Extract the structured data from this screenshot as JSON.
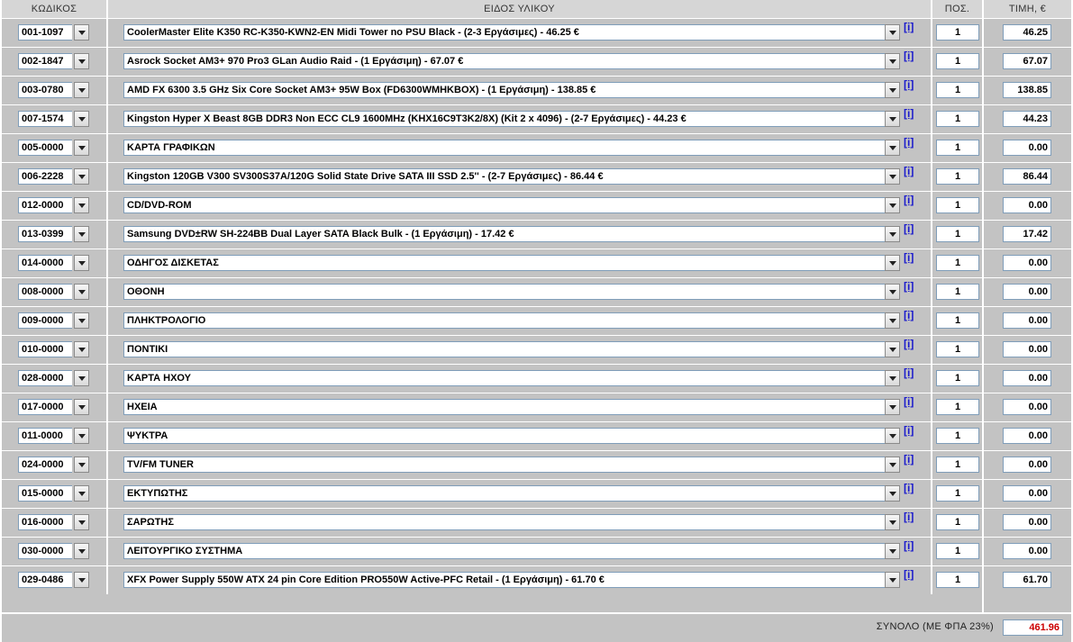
{
  "headers": {
    "code": "ΚΩΔΙΚΟΣ",
    "item": "ΕΙΔΟΣ ΥΛΙΚΟΥ",
    "qty": "ΠΟΣ.",
    "price": "ΤΙΜΗ, €"
  },
  "info_label": "[i]",
  "rows": [
    {
      "code": "001-1097",
      "item": "CoolerMaster Elite K350 RC-K350-KWN2-EN Midi Tower no PSU Black - (2-3 Εργάσιμες) - 46.25 €",
      "qty": "1",
      "price": "46.25"
    },
    {
      "code": "002-1847",
      "item": "Asrock Socket AM3+ 970 Pro3 GLan Audio Raid - (1 Εργάσιμη) - 67.07 €",
      "qty": "1",
      "price": "67.07"
    },
    {
      "code": "003-0780",
      "item": "AMD FX 6300 3.5 GHz Six Core Socket AM3+ 95W Box (FD6300WMHKBOX) - (1 Εργάσιμη) - 138.85 €",
      "qty": "1",
      "price": "138.85"
    },
    {
      "code": "007-1574",
      "item": "Kingston Hyper X Beast 8GB DDR3 Non ECC CL9 1600MHz (KHX16C9T3K2/8X) (Kit 2 x 4096) - (2-7 Εργάσιμες) - 44.23 €",
      "qty": "1",
      "price": "44.23"
    },
    {
      "code": "005-0000",
      "item": "ΚΑΡΤΑ ΓΡΑΦΙΚΩΝ",
      "qty": "1",
      "price": "0.00"
    },
    {
      "code": "006-2228",
      "item": "Kingston 120GB V300 SV300S37A/120G Solid State Drive SATA III SSD 2.5'' - (2-7 Εργάσιμες) - 86.44 €",
      "qty": "1",
      "price": "86.44"
    },
    {
      "code": "012-0000",
      "item": "CD/DVD-ROM",
      "qty": "1",
      "price": "0.00"
    },
    {
      "code": "013-0399",
      "item": "Samsung DVD±RW SH-224BB Dual Layer SATA Black Bulk - (1 Εργάσιμη) - 17.42 €",
      "qty": "1",
      "price": "17.42"
    },
    {
      "code": "014-0000",
      "item": "ΟΔΗΓΟΣ ΔΙΣΚΕΤΑΣ",
      "qty": "1",
      "price": "0.00"
    },
    {
      "code": "008-0000",
      "item": "ΟΘΟΝΗ",
      "qty": "1",
      "price": "0.00"
    },
    {
      "code": "009-0000",
      "item": "ΠΛΗΚΤΡΟΛΟΓΙΟ",
      "qty": "1",
      "price": "0.00"
    },
    {
      "code": "010-0000",
      "item": "ΠΟΝΤΙΚΙ",
      "qty": "1",
      "price": "0.00"
    },
    {
      "code": "028-0000",
      "item": "ΚΑΡΤΑ ΗΧΟΥ",
      "qty": "1",
      "price": "0.00"
    },
    {
      "code": "017-0000",
      "item": "ΗΧΕΙΑ",
      "qty": "1",
      "price": "0.00"
    },
    {
      "code": "011-0000",
      "item": "ΨΥΚΤΡΑ",
      "qty": "1",
      "price": "0.00"
    },
    {
      "code": "024-0000",
      "item": "TV/FM TUNER",
      "qty": "1",
      "price": "0.00"
    },
    {
      "code": "015-0000",
      "item": "ΕΚΤΥΠΩΤΗΣ",
      "qty": "1",
      "price": "0.00"
    },
    {
      "code": "016-0000",
      "item": "ΣΑΡΩΤΗΣ",
      "qty": "1",
      "price": "0.00"
    },
    {
      "code": "030-0000",
      "item": "ΛΕΙΤΟΥΡΓΙΚΟ ΣΥΣΤΗΜΑ",
      "qty": "1",
      "price": "0.00"
    },
    {
      "code": "029-0486",
      "item": "XFX Power Supply 550W ATX 24 pin Core Edition PRO550W Active-PFC Retail - (1 Εργάσιμη) - 61.70 €",
      "qty": "1",
      "price": "61.70"
    }
  ],
  "total": {
    "label": "ΣΥΝΟΛΟ (ΜΕ ΦΠΑ 23%)",
    "value": "461.96"
  },
  "colors": {
    "cell_bg": "#c3c3c3",
    "header_bg": "#d6d6d6",
    "total_value": "#cc0000",
    "info_link": "#1a1acc"
  }
}
